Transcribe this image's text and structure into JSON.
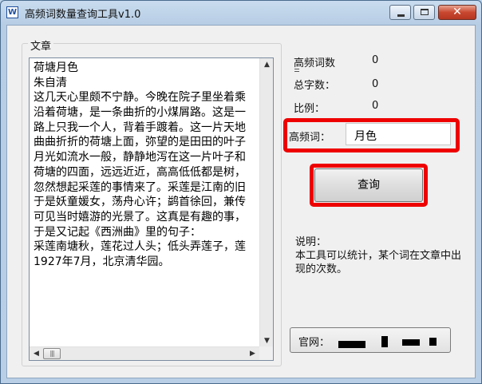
{
  "window": {
    "title": "高频词数量查询工具v1.0",
    "app_icon_text": "W",
    "close_glyph": "✕"
  },
  "article": {
    "group_label": "文章",
    "lines": [
      "荷塘月色",
      "朱自清",
      "这几天心里颇不宁静。今晚在院子里坐着乘",
      "沿着荷塘，是一条曲折的小煤屑路。这是一",
      "路上只我一个人，背着手踱着。这一片天地",
      "曲曲折折的荷塘上面，弥望的是田田的叶子",
      "月光如流水一般，静静地泻在这一片叶子和",
      "荷塘的四面，远远近近，高高低低都是树，",
      "忽然想起采莲的事情来了。采莲是江南的旧",
      "于是妖童媛女，荡舟心许；鹢首徐回，兼传",
      "可见当时嬉游的光景了。这真是有趣的事，",
      "于是又记起《西洲曲》里的句子：",
      "采莲南塘秋，莲花过人头；低头弄莲子，莲",
      "1927年7月，北京清华园。"
    ]
  },
  "stats": {
    "high_freq_count_label": "高频词数",
    "high_freq_count_value": "0",
    "total_chars_label": "总字数：",
    "total_chars_value": "0",
    "ratio_label": "比例：",
    "ratio_value": "0"
  },
  "query": {
    "word_label": "高频词：",
    "word_value": "月色",
    "button_label": "查询"
  },
  "description": {
    "title": "说明：",
    "body": "本工具可以统计，某个词在文章中出现的次数。"
  },
  "website": {
    "label": "官网："
  },
  "colors": {
    "highlight": "#ee0000"
  }
}
